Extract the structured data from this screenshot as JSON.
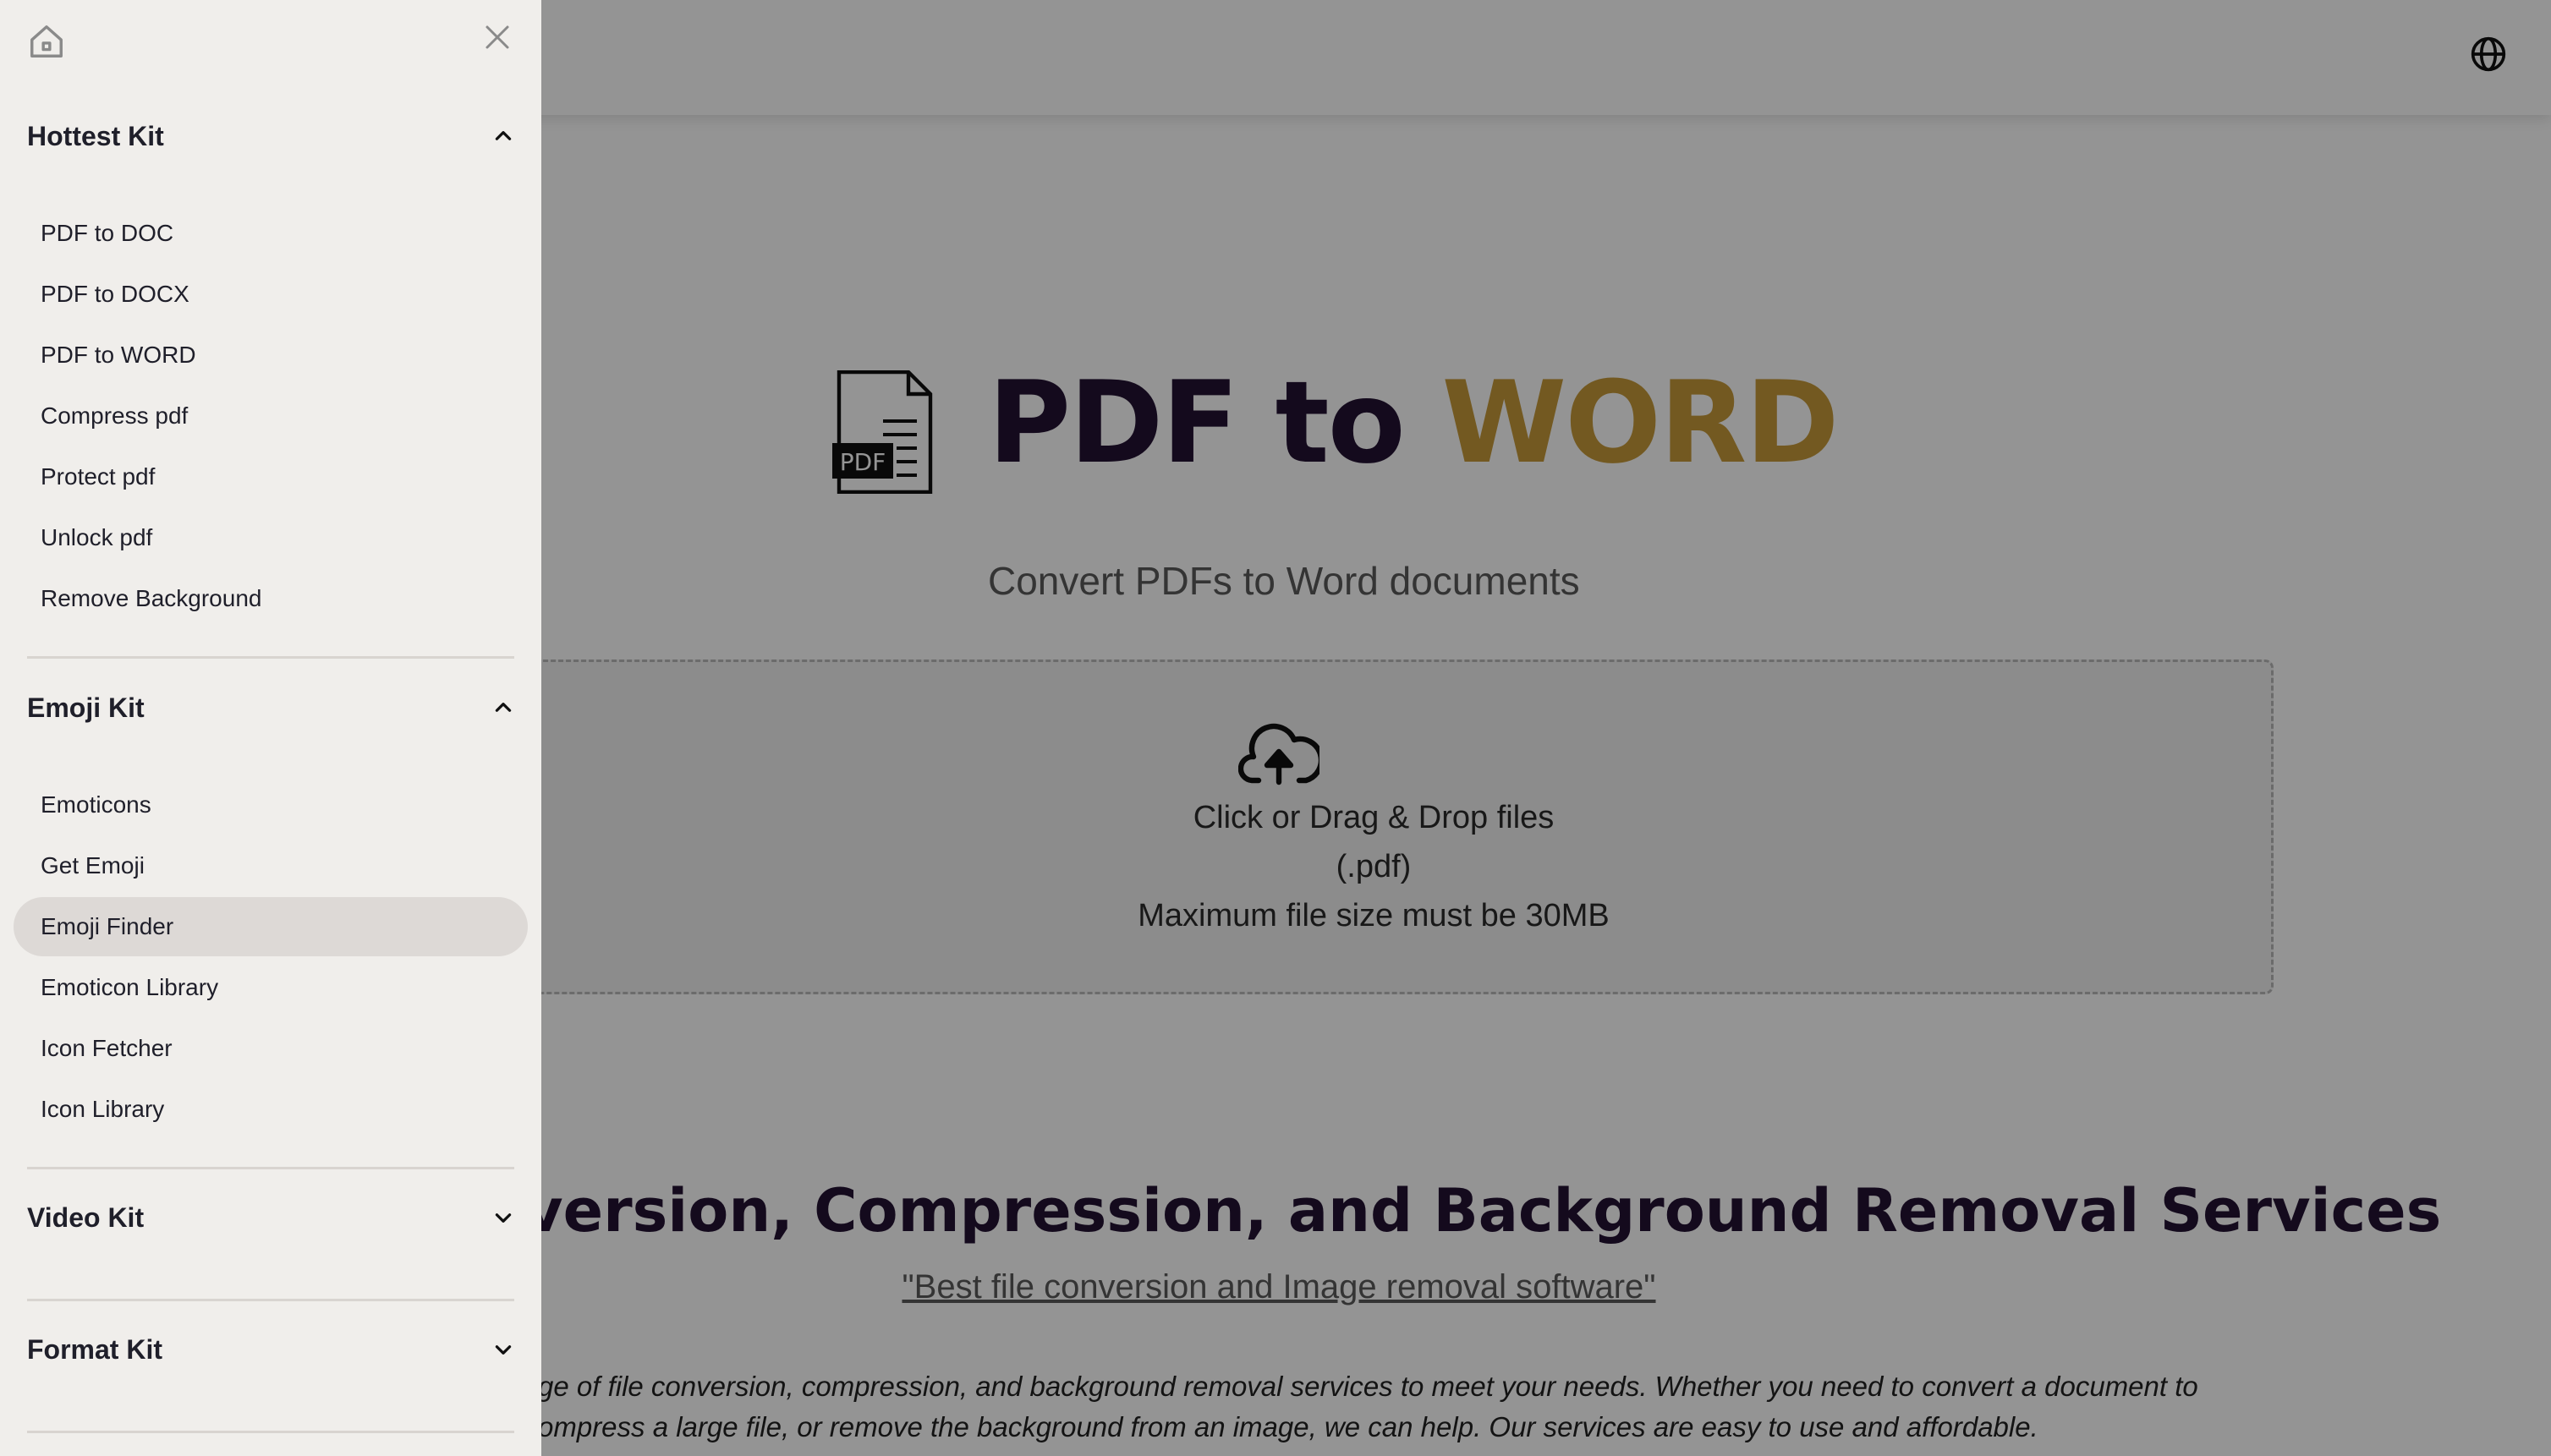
{
  "page": {
    "hero": {
      "title_part1": "PDF to ",
      "title_part2": "WORD",
      "subtitle": "Convert PDFs to Word documents",
      "file_badge": "PDF"
    },
    "dropzone": {
      "line1": "Click or Drag & Drop files",
      "line2": "(.pdf)",
      "line3": "Maximum file size must be 30MB"
    },
    "section_title": "version, Compression, and Background Removal Services",
    "quote_link": "\"Best file conversion and Image removal software\"",
    "description_line1": "ge of file conversion, compression, and background removal services to meet your needs. Whether you need to convert a document to",
    "description_line2": "ompress a large file, or remove the background from an image, we can help. Our services are easy to use and affordable."
  },
  "sidebar": {
    "groups": [
      {
        "label": "Hottest Kit",
        "expanded": true,
        "items": [
          "PDF to DOC",
          "PDF to DOCX",
          "PDF to WORD",
          "Compress pdf",
          "Protect pdf",
          "Unlock pdf",
          "Remove Background"
        ]
      },
      {
        "label": "Emoji Kit",
        "expanded": true,
        "items": [
          "Emoticons",
          "Get Emoji",
          "Emoji Finder",
          "Emoticon Library",
          "Icon Fetcher",
          "Icon Library"
        ],
        "active_item": "Emoji Finder"
      },
      {
        "label": "Video Kit",
        "expanded": false,
        "items": []
      },
      {
        "label": "Format Kit",
        "expanded": false,
        "items": []
      }
    ]
  },
  "colors": {
    "title_dark": "#241233",
    "title_accent": "#c79a3a",
    "sidebar_bg": "#f0eeeb",
    "active_item_bg": "#ddd9d6"
  },
  "icons": {
    "home": "home-icon",
    "close": "close-icon",
    "globe": "globe-icon",
    "upload": "cloud-upload-icon",
    "pdf_file": "pdf-file-icon",
    "chevron_up": "chevron-up-icon",
    "chevron_down": "chevron-down-icon"
  }
}
